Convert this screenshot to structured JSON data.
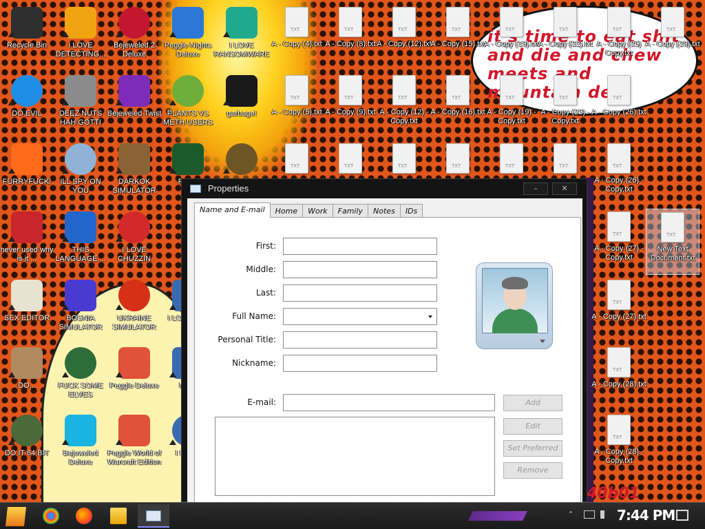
{
  "desktop": {
    "wallpaper_text": "it's time to eat shit and die and chew meets and mountain dew",
    "wallpaper_tag": "40b01",
    "icons": [
      {
        "label": "Recycle Bin",
        "color": "#2f2f2f"
      },
      {
        "label": "I LOVE DETECTING...",
        "color": "#f2a311"
      },
      {
        "label": "Bejeweled 2 Deluxe",
        "color": "#c2172f"
      },
      {
        "label": "Peggle Nights Deluxe",
        "color": "#2b78d6"
      },
      {
        "label": "I LOVE RANSOMWARE",
        "color": "#21a98e"
      },
      {
        "label": "DO EVIL",
        "color": "#1f8ee6"
      },
      {
        "label": "DEEZ NUTS HAH GOTTI",
        "color": "#8b8b8b"
      },
      {
        "label": "Bejeweled Twist",
        "color": "#7d2bb8"
      },
      {
        "label": "PLANTS VS METH USERS",
        "color": "#6fae3a"
      },
      {
        "label": "garbage!",
        "color": "#1a1a1a"
      },
      {
        "label": "FURRYFUCK!",
        "color": "#ff6a1a"
      },
      {
        "label": "ILL SPY ON YOU",
        "color": "#8fb2d6"
      },
      {
        "label": "DARKOK SIMULATOR",
        "color": "#8a6234"
      },
      {
        "label": "Roc...",
        "color": "#1c5a2c"
      },
      {
        "label": "",
        "color": "#6e5526"
      },
      {
        "label": "never used why is it ...",
        "color": "#c9262c"
      },
      {
        "label": "THIS LANGUAGE ...",
        "color": "#2266cc"
      },
      {
        "label": "I LOVE CHUZZIN",
        "color": "#d22a2a"
      },
      {
        "label": "SEX EDITOR",
        "color": "#e8e2d0"
      },
      {
        "label": "BOSNIA SIMULATOR",
        "color": "#4a3bd0"
      },
      {
        "label": "UKRAINE SIMULATOR",
        "color": "#d63018"
      },
      {
        "label": "I LO... MA...",
        "color": "#3a6ab0"
      },
      {
        "label": "DO...",
        "color": "#b08a60"
      },
      {
        "label": "FUCK SOME ELVES",
        "color": "#2e6d3a"
      },
      {
        "label": "Peggle Deluxe",
        "color": "#e0523a"
      },
      {
        "label": "MA...",
        "color": "#3a6ab0"
      },
      {
        "label": "DO IT 64 BIT",
        "color": "#4a6a3a"
      },
      {
        "label": "Bejeweled Deluxe",
        "color": "#1bb4e0"
      },
      {
        "label": "Peggle World of Warcraft Edition",
        "color": "#e0523a"
      },
      {
        "label": "I LOV...",
        "color": "#3a6ab0"
      }
    ],
    "files": [
      {
        "label": "A - Copy (4).txt"
      },
      {
        "label": "A - Copy (8).txt"
      },
      {
        "label": "A - Copy (12).txt"
      },
      {
        "label": "A - Copy (15).txt"
      },
      {
        "label": "A - Copy (19).txt"
      },
      {
        "label": "A - Copy (22).txt"
      },
      {
        "label": "A - Copy (25) Copy.txt"
      },
      {
        "label": "A - Copy (29).txt"
      },
      {
        "label": "A - Copy (5).txt"
      },
      {
        "label": "A - Copy (9).txt"
      },
      {
        "label": "A - Copy (12) - Copy.txt"
      },
      {
        "label": "A - Copy (16).txt"
      },
      {
        "label": "A - Copy (19) - Copy.txt"
      },
      {
        "label": "A - Copy (23) - Copy.txt"
      },
      {
        "label": "A - Copy (26).txt"
      },
      {
        "label": ""
      },
      {
        "label": ""
      },
      {
        "label": ""
      },
      {
        "label": ""
      },
      {
        "label": ""
      },
      {
        "label": ""
      },
      {
        "label": "A - Copy (26) - Copy.txt"
      },
      {
        "label": "A - Copy (27) - Copy.txt"
      },
      {
        "label": "New Text Document.txt"
      },
      {
        "label": "A - Copy (27).txt"
      },
      {
        "label": "A - Copy (28).txt"
      },
      {
        "label": "A - Copy (28) - Copy.txt"
      }
    ]
  },
  "dialog": {
    "title": "Properties",
    "minimize": "–",
    "close": "✕",
    "tabs": [
      "Name and E-mail",
      "Home",
      "Work",
      "Family",
      "Notes",
      "IDs"
    ],
    "fields": {
      "first_label": "First:",
      "middle_label": "Middle:",
      "last_label": "Last:",
      "fullname_label": "Full Name:",
      "title_label": "Personal Title:",
      "nickname_label": "Nickname:",
      "email_label": "E-mail:",
      "first": "",
      "middle": "",
      "last": "",
      "fullname": "",
      "title": "",
      "nickname": "",
      "email": ""
    },
    "buttons": {
      "add": "Add",
      "edit": "Edit",
      "set_preferred": "Set Preferred",
      "remove": "Remove"
    }
  },
  "taskbar": {
    "time": "7:44 PM",
    "tray_arrow": "˄",
    "network_icon": "network-icon",
    "volume_icon": "volume-icon"
  }
}
